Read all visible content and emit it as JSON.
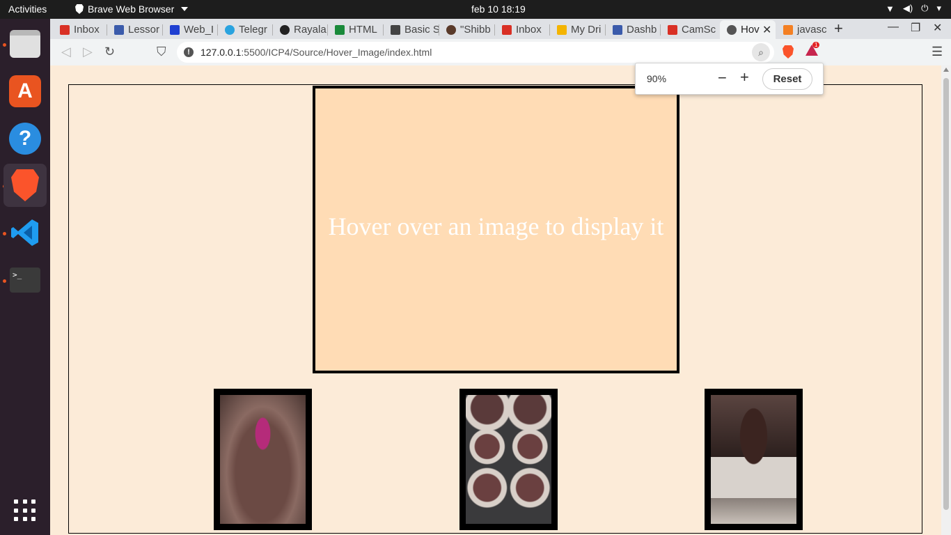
{
  "system_bar": {
    "activities": "Activities",
    "app_name": "Brave Web Browser",
    "clock": "feb 10  18:19"
  },
  "dock": {
    "items": [
      "Files",
      "Ubuntu Software",
      "Help",
      "Brave Web Browser",
      "Visual Studio Code",
      "Terminal"
    ],
    "terminal_glyph": ">_",
    "appstore_glyph": "A",
    "help_glyph": "?"
  },
  "tabs": [
    {
      "label": "Inbox",
      "favicon_color": "#d93025"
    },
    {
      "label": "Lessor",
      "favicon_color": "#3b5bab"
    },
    {
      "label": "Web_I",
      "favicon_color": "#1f3fd1"
    },
    {
      "label": "Telegr",
      "favicon_color": "#2aa3df"
    },
    {
      "label": "Rayala",
      "favicon_color": "#222222"
    },
    {
      "label": "HTML",
      "favicon_color": "#1a8a3a"
    },
    {
      "label": "Basic S",
      "favicon_color": "#444444"
    },
    {
      "label": "\"Shibb",
      "favicon_color": "#5a3a2a"
    },
    {
      "label": "Inbox",
      "favicon_color": "#d93025"
    },
    {
      "label": "My Dri",
      "favicon_color": "#f4b400"
    },
    {
      "label": "Dashb",
      "favicon_color": "#3b5bab"
    },
    {
      "label": "CamSc",
      "favicon_color": "#d93025"
    },
    {
      "label": "Hov",
      "favicon_color": "#555555",
      "active": true
    },
    {
      "label": "javasc",
      "favicon_color": "#f48024"
    }
  ],
  "address_bar": {
    "url_host": "127.0.0.1",
    "url_path": ":5500/ICP4/Source/Hover_Image/index.html"
  },
  "zoom_popup": {
    "level": "90%",
    "minus": "−",
    "plus": "+",
    "reset": "Reset"
  },
  "page": {
    "display_message": "Hover over an image to display it",
    "thumbnails": [
      {
        "name": "batter-bowl-image",
        "style": "batter"
      },
      {
        "name": "cupcake-tin-image",
        "style": "tin"
      },
      {
        "name": "frosted-cupcake-image",
        "style": "cupcake"
      }
    ]
  },
  "colors": {
    "page_bg": "#fcebd8",
    "display_bg": "#ffdcb5",
    "brave_orange": "#fb542b"
  }
}
